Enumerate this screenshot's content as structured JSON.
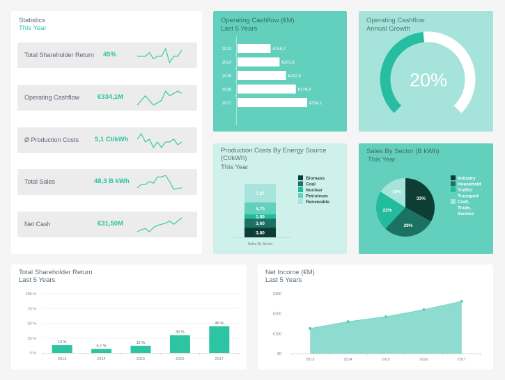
{
  "statistics": {
    "title": "Statistics",
    "subtitle": "This Year",
    "rows": [
      {
        "label": "Total Shareholder Return",
        "value": "45%",
        "spark": [
          5,
          5,
          5,
          8,
          3,
          5,
          5,
          11,
          0,
          5,
          5,
          10
        ]
      },
      {
        "label": "Operating Cashflow",
        "value": "€334,1M",
        "spark": [
          4,
          5,
          6,
          5,
          4,
          4.5,
          5,
          7,
          6,
          6.5,
          7,
          6.5
        ]
      },
      {
        "label": "Ø Production Costs",
        "value": "5,1 Ct/kWh",
        "spark": [
          7,
          9,
          6,
          7,
          4,
          6,
          4,
          6,
          6,
          7,
          5,
          6
        ]
      },
      {
        "label": "Total Sales",
        "value": "48,3 B kWh",
        "spark": [
          3,
          5,
          5,
          7,
          6,
          10,
          10,
          11,
          7,
          2,
          2.5,
          3
        ]
      },
      {
        "label": "Net Cash",
        "value": "€31,50M",
        "spark": [
          1,
          2,
          2.5,
          1,
          3,
          4,
          4.5,
          5,
          6,
          4.5,
          6,
          7.5
        ]
      }
    ]
  },
  "cashflow_bars": {
    "title": "Operating Cashflow (€M)",
    "subtitle": "Last 5 Years",
    "chart_data": {
      "type": "bar",
      "orientation": "horizontal",
      "categories": [
        "2013",
        "2014",
        "2015",
        "2016",
        "2017"
      ],
      "values": [
        158.7,
        201.6,
        232.6,
        279.9,
        334.1
      ],
      "labels": [
        "€158,7",
        "€201,6",
        "€232,6",
        "€279,9",
        "€334,1"
      ],
      "xlim": [
        0,
        334.1
      ]
    }
  },
  "gauge": {
    "title": "Operating Cashflow",
    "subtitle": "Annual Growth",
    "value_label": "20%",
    "fill_fraction": 0.48,
    "fill_color": "#26bda0",
    "track_color": "#ffffff"
  },
  "production_costs": {
    "title_line1": "Production Costs By Energy Source",
    "title_line2": "(Ct/kWh)",
    "subtitle": "This Year",
    "chart_data": {
      "type": "bar",
      "stacked": true,
      "categories": [
        "Sales By Sector"
      ],
      "series": [
        {
          "name": "Biomass",
          "values": [
            3.8
          ],
          "label": "3,80",
          "color": "#0e3d35"
        },
        {
          "name": "Coal",
          "values": [
            3.6
          ],
          "label": "3,60",
          "color": "#1b7263"
        },
        {
          "name": "Nuclear",
          "values": [
            1.6
          ],
          "label": "1,60",
          "color": "#22bc9d"
        },
        {
          "name": "Petroleum",
          "values": [
            4.7
          ],
          "label": "4,70",
          "color": "#63d0be"
        },
        {
          "name": "Renewable",
          "values": [
            7.27
          ],
          "label": "7,27",
          "color": "#a7e5dc"
        }
      ],
      "xlabel": "Sales By Sector",
      "legend": "right"
    }
  },
  "sales_by_sector": {
    "title": "Sales By Sector (B kWh)",
    "subtitle": "This Year",
    "chart_data": {
      "type": "pie",
      "slices": [
        {
          "name": "Industry",
          "value": 33,
          "label": "33%",
          "color": "#0e3d35"
        },
        {
          "name": "Household",
          "value": 29,
          "label": "29%",
          "color": "#1b7263"
        },
        {
          "name": "Traffic/ Transport",
          "value": 22,
          "label": "22%",
          "color": "#22bc9d"
        },
        {
          "name": "Craft, Trade, Service",
          "value": 16,
          "label": "16%",
          "color": "#a7e5dc"
        }
      ],
      "legend_lines": [
        [
          "Industry"
        ],
        [
          "Household"
        ],
        [
          "Traffic/",
          "Transport"
        ],
        [
          "Craft,",
          "Trade,",
          "Service"
        ]
      ],
      "legend": "right"
    }
  },
  "shareholder_return": {
    "title": "Total Shareholder Return",
    "subtitle": "Last 5 Years",
    "chart_data": {
      "type": "bar",
      "categories": [
        "2013",
        "2014",
        "2015",
        "2016",
        "2017"
      ],
      "values": [
        13,
        6.7,
        12,
        30,
        45
      ],
      "labels": [
        "13 %",
        "6,7 %",
        "12 %",
        "30 %",
        "45 %"
      ],
      "yticks": [
        "0 %",
        "25 %",
        "50 %",
        "75 %",
        "100 %"
      ],
      "ylim": [
        0,
        100
      ],
      "grid": true,
      "color": "#2cc4a1"
    }
  },
  "net_income": {
    "title": "Net Income (€M)",
    "subtitle": "Last 5 Years",
    "chart_data": {
      "type": "area",
      "x": [
        "2013",
        "2014",
        "2015",
        "2016",
        "2017"
      ],
      "values": [
        126,
        160,
        185,
        220,
        262
      ],
      "yticks": [
        "€0",
        "€100",
        "€200",
        "€300"
      ],
      "ylim": [
        0,
        300
      ],
      "color": "#8edccf",
      "line_color": "#5ccab5"
    }
  }
}
